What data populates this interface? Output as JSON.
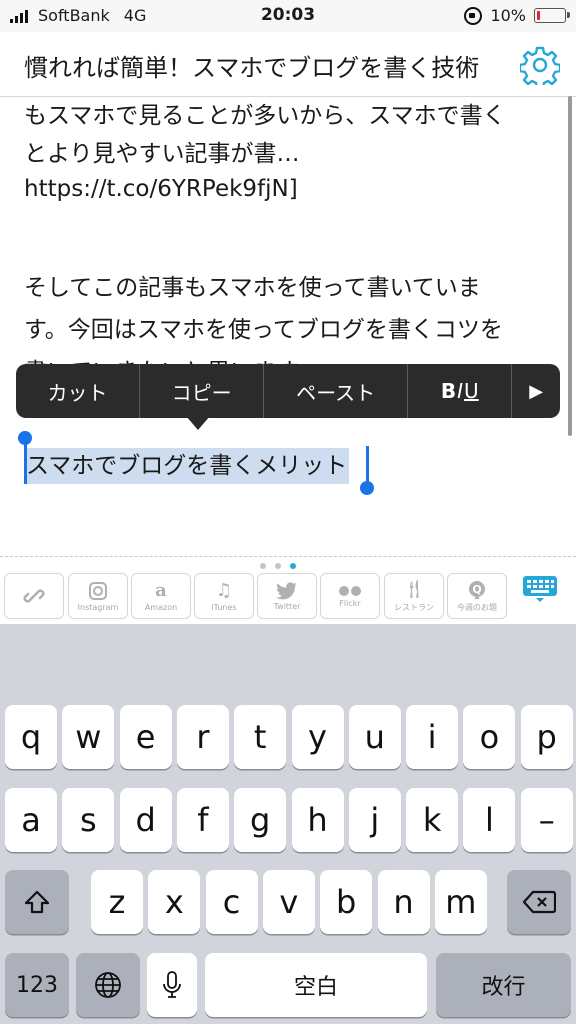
{
  "status_bar": {
    "carrier": "SoftBank",
    "network": "4G",
    "time": "20:03",
    "battery_percent": "10%",
    "battery_level": 0.1
  },
  "header": {
    "title": "慣れれば簡単！スマホでブログを書く技術",
    "settings_icon": "gear-icon"
  },
  "article": {
    "lines": [
      "もスマホで見ることが多いから、スマホで書く",
      "とより見やすい記事が書…",
      "https://t.co/6YRPek9fjN]",
      "",
      "そしてこの記事もスマホを使って書いていま",
      "す。今回はスマホを使ってブログを書くコツを",
      "書いていきたいと思います。"
    ],
    "selected_text": "スマホでブログを書くメリット"
  },
  "edit_menu": {
    "cut": "カット",
    "copy": "コピー",
    "paste": "ペースト",
    "format_b": "B",
    "format_i": "I",
    "format_u": "U",
    "more": "▶"
  },
  "toolbar": {
    "items": [
      {
        "icon": "link-icon",
        "label": ""
      },
      {
        "icon": "instagram-icon",
        "label": "Instagram"
      },
      {
        "icon": "amazon-icon",
        "label": "Amazon"
      },
      {
        "icon": "itunes-icon",
        "label": "iTunes"
      },
      {
        "icon": "twitter-icon",
        "label": "Twitter"
      },
      {
        "icon": "flickr-icon",
        "label": "Flickr"
      },
      {
        "icon": "restaurant-icon",
        "label": "レストラン"
      },
      {
        "icon": "question-icon",
        "label": "今週のお題"
      }
    ],
    "keyboard_icon": "keyboard-hide-icon"
  },
  "keyboard": {
    "row1": [
      "q",
      "w",
      "e",
      "r",
      "t",
      "y",
      "u",
      "i",
      "o",
      "p"
    ],
    "row2": [
      "a",
      "s",
      "d",
      "f",
      "g",
      "h",
      "j",
      "k",
      "l",
      "–"
    ],
    "row3": [
      "z",
      "x",
      "c",
      "v",
      "b",
      "n",
      "m"
    ],
    "numbers": "123",
    "space": "空白",
    "return": "改行"
  },
  "colors": {
    "accent": "#27a7d8",
    "selection": "#cddcef",
    "selection_handle": "#1a73e8",
    "menu_bg": "#2b2b2b",
    "keyboard_bg": "#d1d4db",
    "battery_low": "#e0262b"
  }
}
